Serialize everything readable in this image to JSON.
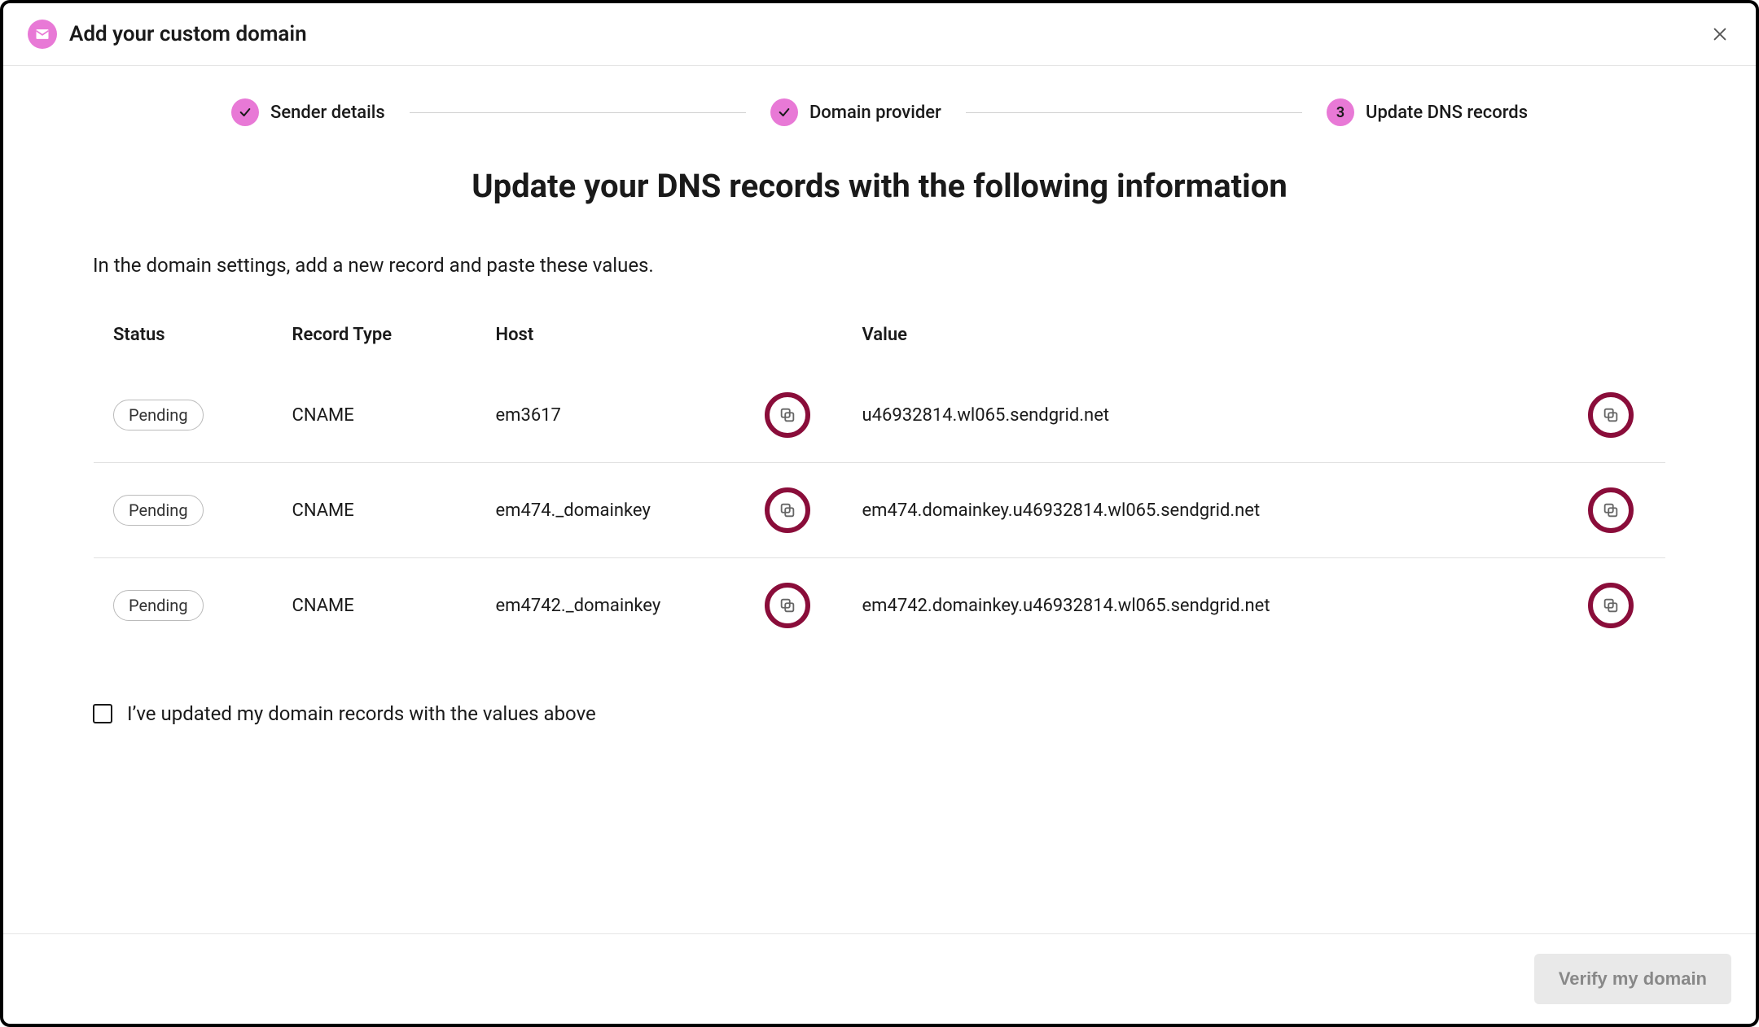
{
  "header": {
    "title": "Add your custom domain"
  },
  "stepper": {
    "steps": [
      {
        "label": "Sender details",
        "done": true
      },
      {
        "label": "Domain provider",
        "done": true
      },
      {
        "label": "Update DNS records",
        "number": "3",
        "done": false
      }
    ]
  },
  "main": {
    "title": "Update your DNS records with the following information",
    "instruction": "In the domain settings, add a new record and paste these values."
  },
  "table": {
    "headers": {
      "status": "Status",
      "type": "Record Type",
      "host": "Host",
      "value": "Value"
    },
    "rows": [
      {
        "status": "Pending",
        "type": "CNAME",
        "host": "em3617",
        "value": "u46932814.wl065.sendgrid.net"
      },
      {
        "status": "Pending",
        "type": "CNAME",
        "host": "em474._domainkey",
        "value": "em474.domainkey.u46932814.wl065.sendgrid.net"
      },
      {
        "status": "Pending",
        "type": "CNAME",
        "host": "em4742._domainkey",
        "value": "em4742.domainkey.u46932814.wl065.sendgrid.net"
      }
    ]
  },
  "confirm": {
    "label": "I’ve updated my domain records with the values above"
  },
  "footer": {
    "verify_label": "Verify my domain"
  }
}
